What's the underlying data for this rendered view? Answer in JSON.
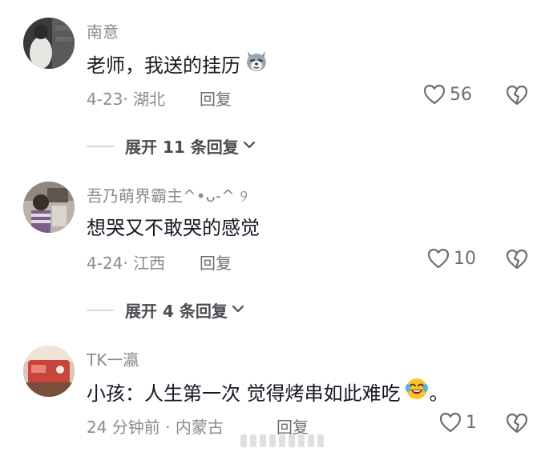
{
  "comments": [
    {
      "username": "南意",
      "text": "老师，我送的挂历",
      "emoji": "wolf-emoji",
      "meta": "4-23· 湖北",
      "reply_label": "回复",
      "likes": "56",
      "expand_label": "展开 11 条回复"
    },
    {
      "username": "吾乃萌界霸主^•ᴗ-^ ୨",
      "text": "想哭又不敢哭的感觉",
      "meta": "4-24· 江西",
      "reply_label": "回复",
      "likes": "10",
      "expand_label": "展开 4 条回复"
    },
    {
      "username": "TK一瀛",
      "text": "小孩：人生第一次 觉得烤串如此难吃",
      "emoji": "laughing-crying-emoji",
      "text_suffix": "。",
      "meta": "24 分钟前 · 内蒙古",
      "reply_label": "回复",
      "likes": "1"
    }
  ],
  "colors": {
    "primary_text": "#161823",
    "secondary_text": "#8a8a8f",
    "icon": "#6d6d72"
  }
}
